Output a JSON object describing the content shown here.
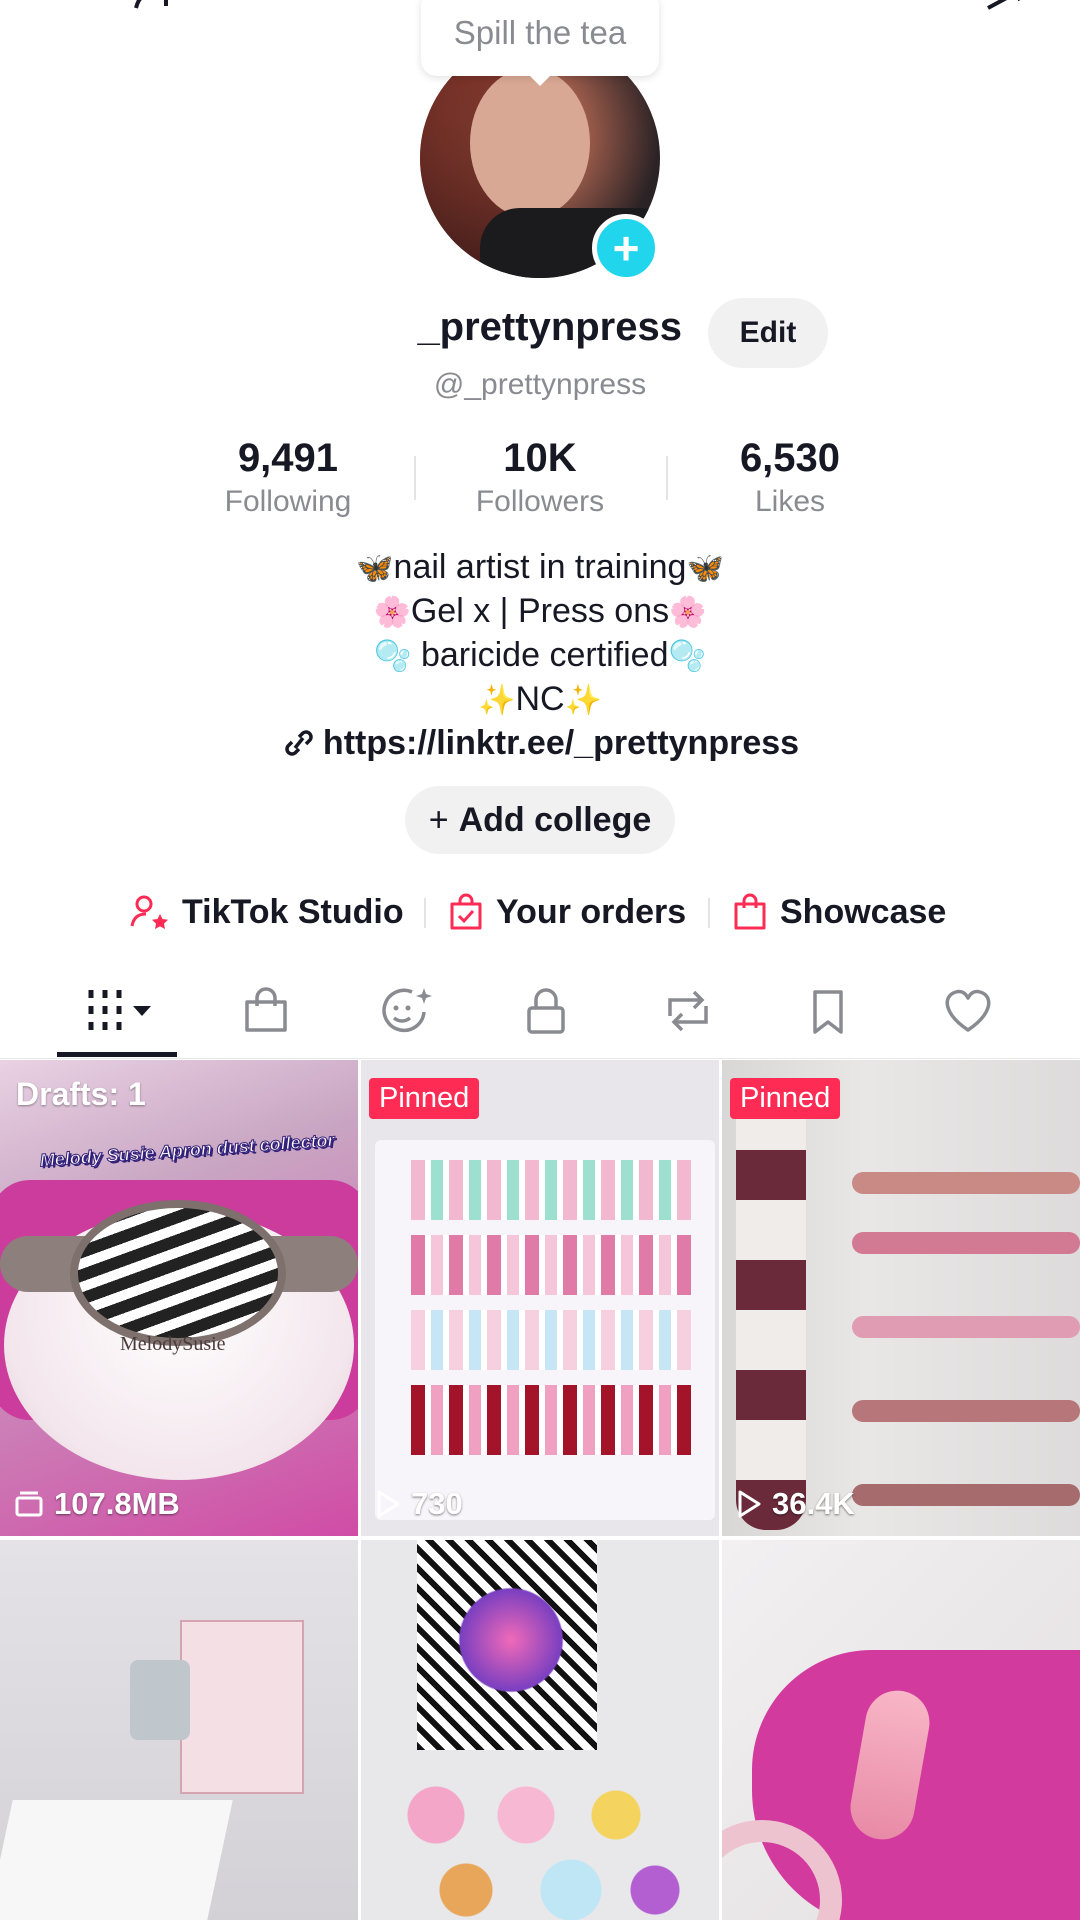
{
  "tooltip": "Spill the tea",
  "profile": {
    "username": "_prettynpress",
    "edit_label": "Edit",
    "handle": "@_prettynpress"
  },
  "stats": [
    {
      "value": "9,491",
      "label": "Following"
    },
    {
      "value": "10K",
      "label": "Followers"
    },
    {
      "value": "6,530",
      "label": "Likes"
    }
  ],
  "bio": {
    "line1": "nail artist in training",
    "line2": "Gel x | Press ons",
    "line3": "baricide certified",
    "line4": "NC",
    "emoji_butterfly": "🦋",
    "emoji_flower": "🌸",
    "emoji_bubbles": "🫧",
    "emoji_sparkles": "✨"
  },
  "link": "https://linktr.ee/_prettynpress",
  "add_college": "Add college",
  "quick_links": [
    {
      "label": "TikTok Studio",
      "icon": "person-star-icon"
    },
    {
      "label": "Your orders",
      "icon": "bag-check-icon"
    },
    {
      "label": "Showcase",
      "icon": "shopping-bag-icon"
    }
  ],
  "tabs": [
    {
      "name": "videos",
      "icon": "grid-dropdown-icon"
    },
    {
      "name": "shop",
      "icon": "shopping-bag-icon"
    },
    {
      "name": "sparkle",
      "icon": "face-sparkle-icon"
    },
    {
      "name": "private",
      "icon": "lock-icon"
    },
    {
      "name": "reposts",
      "icon": "repost-icon"
    },
    {
      "name": "favorites",
      "icon": "bookmark-icon"
    },
    {
      "name": "liked",
      "icon": "heart-icon"
    }
  ],
  "videos": [
    {
      "badge_type": "drafts",
      "badge": "Drafts: 1",
      "count": "107.8MB",
      "count_icon": "drafts-stack-icon",
      "overlay_text": "Melody Susie Apron dust collector",
      "brand_text": "MelodySusie"
    },
    {
      "badge_type": "pinned",
      "badge": "Pinned",
      "count": "730",
      "count_icon": "play-icon"
    },
    {
      "badge_type": "pinned",
      "badge": "Pinned",
      "count": "36.4K",
      "count_icon": "play-icon"
    },
    {
      "badge_type": "none",
      "badge": "",
      "count": ""
    },
    {
      "badge_type": "none",
      "badge": "",
      "count": ""
    },
    {
      "badge_type": "none",
      "badge": "",
      "count": ""
    }
  ],
  "colors": {
    "accent_red": "#fe2c55",
    "add_blue": "#20d5ec",
    "text_primary": "#161823",
    "text_secondary": "#8a8b91",
    "glove_pink": "#d63ea0"
  }
}
